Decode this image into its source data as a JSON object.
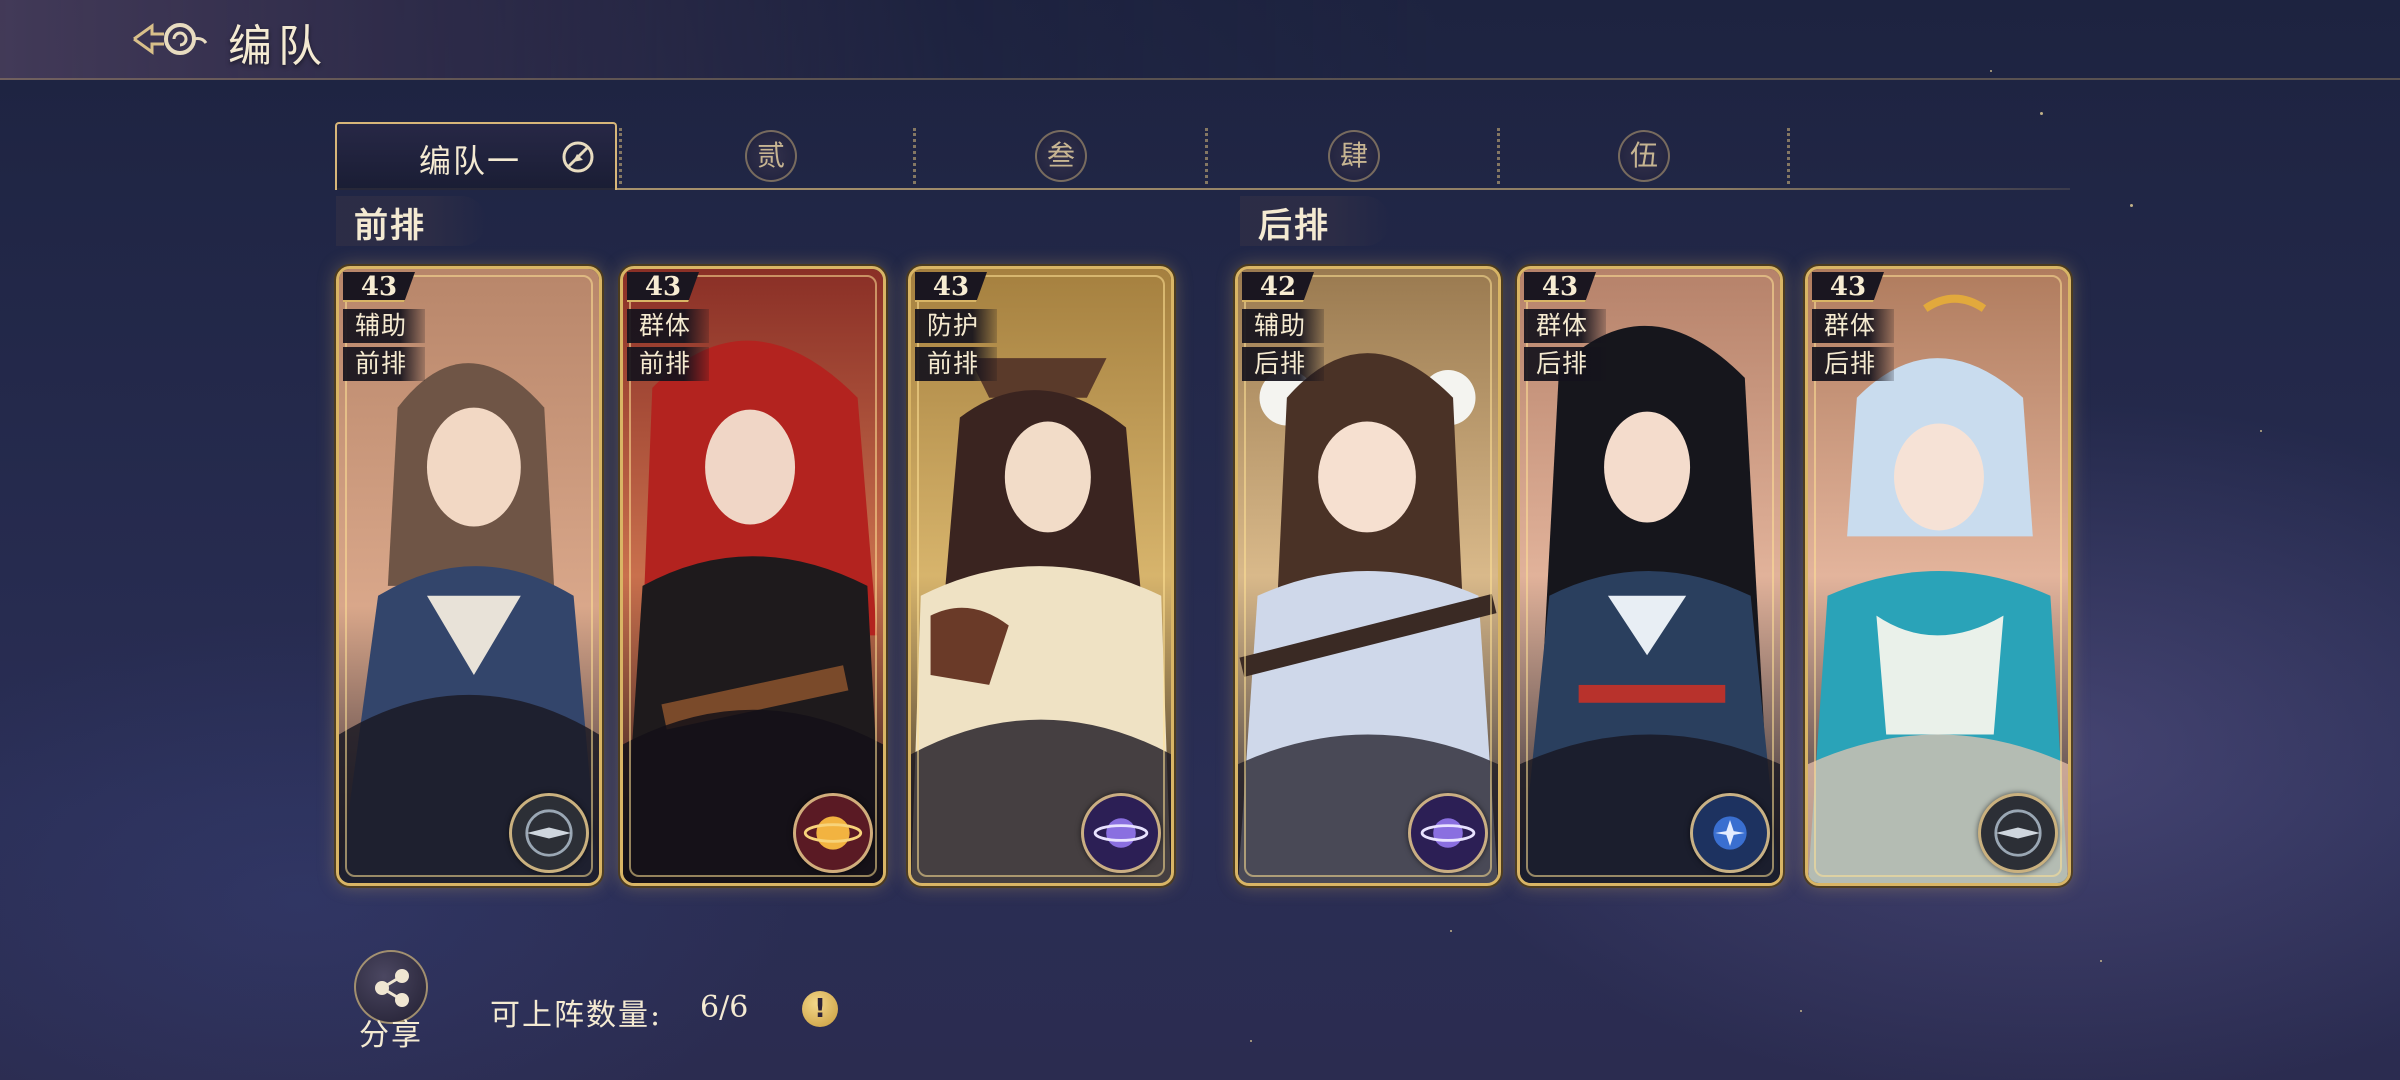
{
  "header": {
    "title": "编队"
  },
  "tabs": {
    "active_label": "编队一",
    "items": [
      {
        "label": "贰"
      },
      {
        "label": "叁"
      },
      {
        "label": "肆"
      },
      {
        "label": "伍"
      }
    ]
  },
  "rows": {
    "front_label": "前排",
    "back_label": "后排"
  },
  "cards": [
    {
      "level": "43",
      "tag1": "辅助",
      "tag2": "前排",
      "element": "compass-icon",
      "accent": "#8c9aa8"
    },
    {
      "level": "43",
      "tag1": "群体",
      "tag2": "前排",
      "element": "sun-orb-icon",
      "accent": "#e8a23a"
    },
    {
      "level": "43",
      "tag1": "防护",
      "tag2": "前排",
      "element": "moon-orb-icon",
      "accent": "#5a3fa0"
    },
    {
      "level": "42",
      "tag1": "辅助",
      "tag2": "后排",
      "element": "moon-orb-icon",
      "accent": "#5a3fa0"
    },
    {
      "level": "43",
      "tag1": "群体",
      "tag2": "后排",
      "element": "star-orb-icon",
      "accent": "#2f62b5"
    },
    {
      "level": "43",
      "tag1": "群体",
      "tag2": "后排",
      "element": "compass-icon",
      "accent": "#8c9aa8"
    }
  ],
  "footer": {
    "share_label": "分享",
    "deploy_label": "可上阵数量:",
    "deploy_value": "6/6",
    "info_icon": "!"
  }
}
